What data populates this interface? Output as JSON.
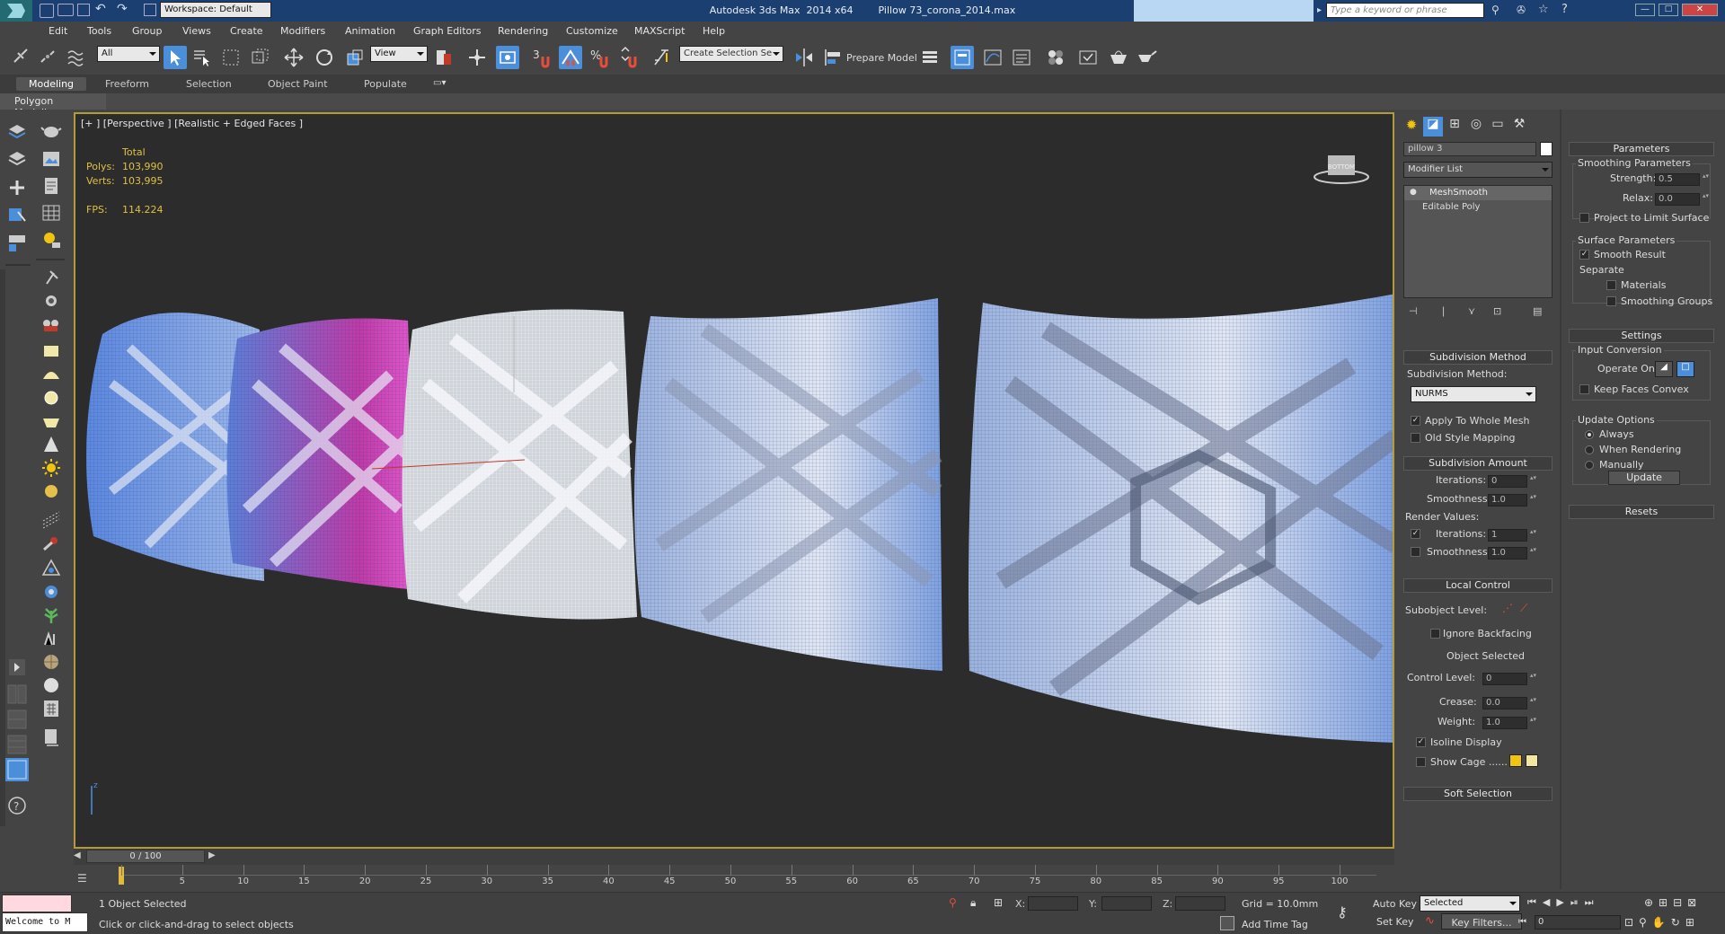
{
  "title": {
    "app": "Autodesk 3ds Max  2014 x64",
    "file": "Pillow 73_corona_2014.max"
  },
  "workspace": "Workspace: Default",
  "search_placeholder": "Type a keyword or phrase",
  "menu": [
    "Edit",
    "Tools",
    "Group",
    "Views",
    "Create",
    "Modifiers",
    "Animation",
    "Graph Editors",
    "Rendering",
    "Customize",
    "MAXScript",
    "Help"
  ],
  "toolbar": {
    "filter": "All",
    "ref_coord": "View",
    "selection_set": "Create Selection Se",
    "prepare_model": "Prepare Model",
    "snap_3": "3",
    "snap_pct": "%"
  },
  "ribbon": {
    "tabs": [
      "Modeling",
      "Freeform",
      "Selection",
      "Object Paint",
      "Populate"
    ],
    "active_tab": "Modeling",
    "panel": "Polygon Modeling"
  },
  "viewport": {
    "label": "[+ ] [Perspective ] [Realistic + Edged Faces ]",
    "stats": {
      "total_label": "Total",
      "polys_label": "Polys:",
      "polys": "103,990",
      "verts_label": "Verts:",
      "verts": "103,995",
      "fps_label": "FPS:",
      "fps": "114.224"
    },
    "viewcube": "BOTTOM",
    "axis_z": "z"
  },
  "timeline": {
    "frame": "0 / 100",
    "ticks": [
      0,
      5,
      10,
      15,
      20,
      25,
      30,
      35,
      40,
      45,
      50,
      55,
      60,
      65,
      70,
      75,
      80,
      85,
      90,
      95,
      100
    ]
  },
  "status": {
    "listener": "Welcome to M",
    "selection": "1 Object Selected",
    "prompt": "Click or click-and-drag to select objects",
    "x_label": "X:",
    "y_label": "Y:",
    "z_label": "Z:",
    "grid": "Grid = 10.0mm",
    "add_time_tag": "Add Time Tag",
    "auto_key": "Auto Key",
    "set_key": "Set Key",
    "key_mode": "Selected",
    "key_filters": "Key Filters...",
    "frame_field": "0"
  },
  "command_panel": {
    "object_name": "pillow 3",
    "modifier_list": "Modifier List",
    "stack": [
      "MeshSmooth",
      "Editable Poly"
    ],
    "subdivision_method": {
      "header": "Subdivision Method",
      "label": "Subdivision Method:",
      "value": "NURMS",
      "apply_whole": "Apply To Whole Mesh",
      "old_style": "Old Style Mapping"
    },
    "subdivision_amount": {
      "header": "Subdivision Amount",
      "iterations_label": "Iterations:",
      "iterations": "0",
      "smoothness_label": "Smoothness:",
      "smoothness": "1.0",
      "render_values": "Render Values:",
      "r_iterations_label": "Iterations:",
      "r_iterations": "1",
      "r_smoothness_label": "Smoothness:",
      "r_smoothness": "1.0"
    },
    "local_control": {
      "header": "Local Control",
      "subobject_label": "Subobject Level:",
      "ignore_backfacing": "Ignore Backfacing",
      "object_selected": "Object Selected",
      "control_level_label": "Control Level:",
      "control_level": "0",
      "crease_label": "Crease:",
      "crease": "0.0",
      "weight_label": "Weight:",
      "weight": "1.0",
      "isoline": "Isoline Display",
      "show_cage": "Show Cage ......"
    },
    "soft_selection": "Soft Selection",
    "parameters": {
      "header": "Parameters",
      "smoothing_params": "Smoothing Parameters",
      "strength_label": "Strength:",
      "strength": "0.5",
      "relax_label": "Relax:",
      "relax": "0.0",
      "project_limit": "Project to Limit Surface",
      "surface_params": "Surface Parameters",
      "smooth_result": "Smooth Result",
      "separate": "Separate",
      "materials": "Materials",
      "smoothing_groups": "Smoothing Groups"
    },
    "settings": {
      "header": "Settings",
      "input_conversion": "Input Conversion",
      "operate_on": "Operate On:",
      "keep_faces": "Keep Faces Convex",
      "update_options": "Update Options",
      "always": "Always",
      "when_rendering": "When Rendering",
      "manually": "Manually",
      "update": "Update"
    },
    "resets": "Resets"
  },
  "colors": {
    "viewport_border": "#b59a3c",
    "title_bar": "#1c3f71",
    "accent": "#4b8ed9",
    "stats": "#e0c040",
    "pillow_blue": "#7aa4e8",
    "pillow_magenta": "#c03aa8",
    "cage_yellow": "#f1c40f"
  }
}
